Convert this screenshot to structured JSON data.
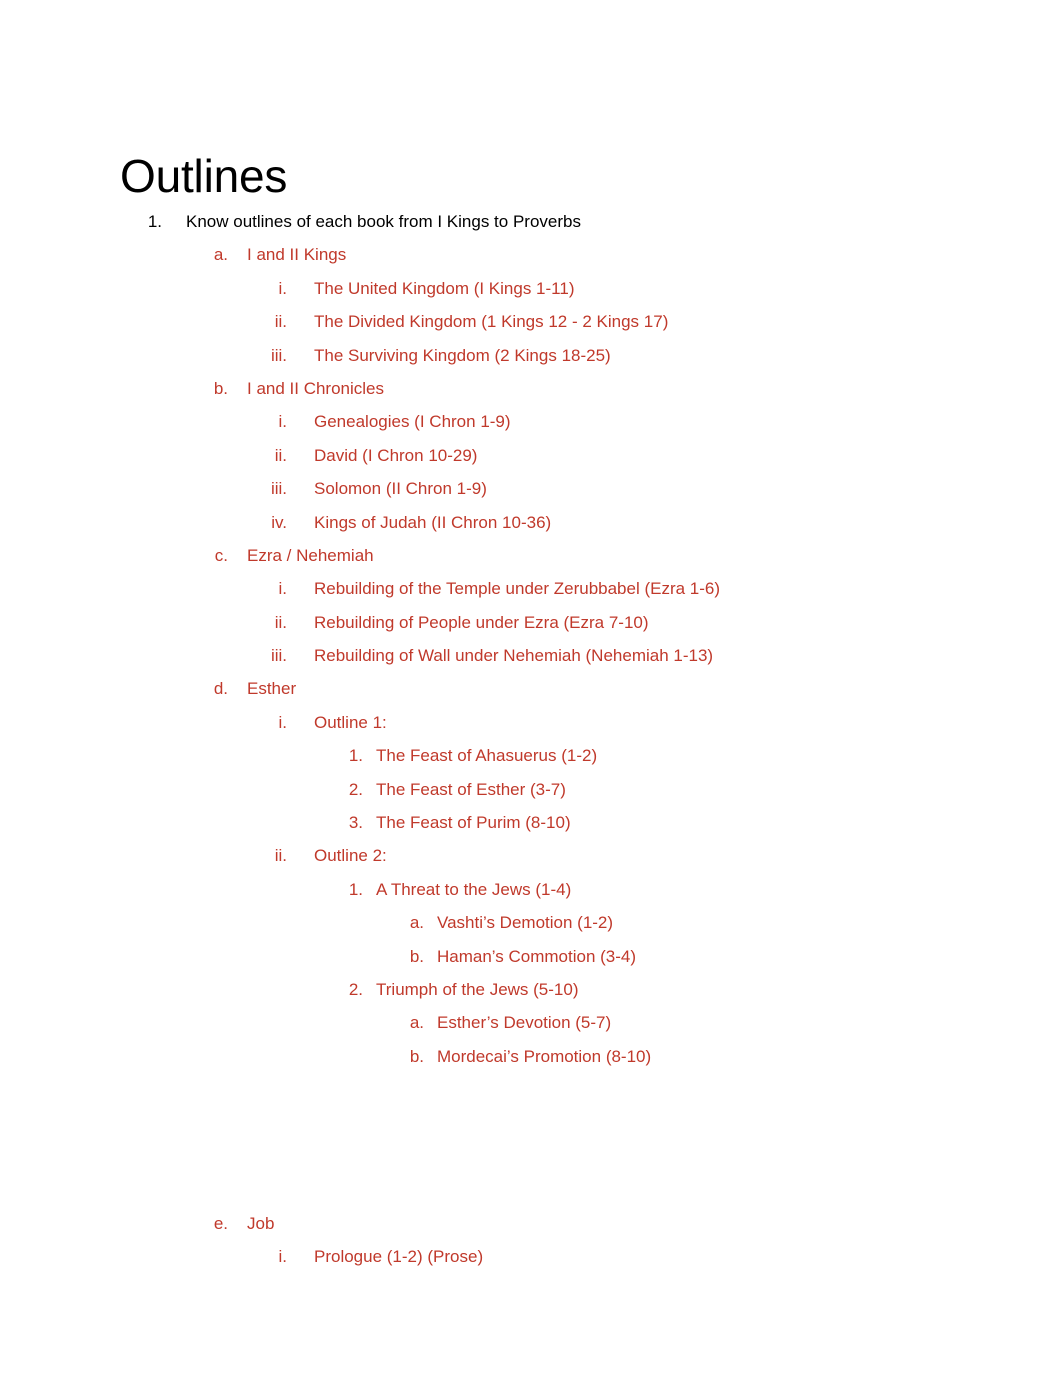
{
  "document": {
    "title": "Outlines",
    "accent_color": "#C0392B",
    "text_color": "#000000",
    "background_color": "#FFFFFF"
  },
  "outline": {
    "items": [
      {
        "level": 1,
        "marker": "1.",
        "text": "Know outlines of each book from I Kings to Proverbs"
      },
      {
        "level": 2,
        "marker": "a.",
        "text": "I and II Kings"
      },
      {
        "level": 3,
        "marker": "i.",
        "text": "The United Kingdom (I Kings 1-11)"
      },
      {
        "level": 3,
        "marker": "ii.",
        "text": "The Divided Kingdom (1 Kings 12 - 2 Kings 17)"
      },
      {
        "level": 3,
        "marker": "iii.",
        "text": "The Surviving Kingdom (2 Kings 18-25)"
      },
      {
        "level": 2,
        "marker": "b.",
        "text": "I and II Chronicles"
      },
      {
        "level": 3,
        "marker": "i.",
        "text": "Genealogies (I Chron 1-9)"
      },
      {
        "level": 3,
        "marker": "ii.",
        "text": "David (I Chron 10-29)"
      },
      {
        "level": 3,
        "marker": "iii.",
        "text": "Solomon (II Chron 1-9)"
      },
      {
        "level": 3,
        "marker": "iv.",
        "text": "Kings of Judah (II Chron 10-36)"
      },
      {
        "level": 2,
        "marker": "c.",
        "text": "Ezra / Nehemiah"
      },
      {
        "level": 3,
        "marker": "i.",
        "text": "Rebuilding of the Temple under Zerubbabel (Ezra 1-6)"
      },
      {
        "level": 3,
        "marker": "ii.",
        "text": "Rebuilding of People under Ezra (Ezra 7-10)"
      },
      {
        "level": 3,
        "marker": "iii.",
        "text": "Rebuilding of Wall under Nehemiah (Nehemiah 1-13)"
      },
      {
        "level": 2,
        "marker": "d.",
        "text": "Esther"
      },
      {
        "level": 3,
        "marker": "i.",
        "text": "Outline 1:"
      },
      {
        "level": 4,
        "marker": "1.",
        "text": "The Feast of Ahasuerus (1-2)"
      },
      {
        "level": 4,
        "marker": "2.",
        "text": "The Feast of Esther (3-7)"
      },
      {
        "level": 4,
        "marker": "3.",
        "text": "The Feast of Purim (8-10)"
      },
      {
        "level": 3,
        "marker": "ii.",
        "text": "Outline 2:"
      },
      {
        "level": 4,
        "marker": "1.",
        "text": "A Threat to the Jews (1-4)"
      },
      {
        "level": 5,
        "marker": "a.",
        "text": "Vashti’s Demotion (1-2)"
      },
      {
        "level": 5,
        "marker": "b.",
        "text": "Haman’s Commotion (3-4)"
      },
      {
        "level": 4,
        "marker": "2.",
        "text": "Triumph of the Jews (5-10)"
      },
      {
        "level": 5,
        "marker": "a.",
        "text": "Esther’s Devotion (5-7)"
      },
      {
        "level": 5,
        "marker": "b.",
        "text": "Mordecai’s Promotion (8-10)"
      },
      {
        "level": 0,
        "marker": "",
        "text": ""
      },
      {
        "level": 0,
        "marker": "",
        "text": ""
      },
      {
        "level": 0,
        "marker": "",
        "text": ""
      },
      {
        "level": 0,
        "marker": "",
        "text": ""
      },
      {
        "level": 2,
        "marker": "e.",
        "text": "Job"
      },
      {
        "level": 3,
        "marker": "i.",
        "text": "Prologue (1-2) (Prose)"
      }
    ]
  }
}
